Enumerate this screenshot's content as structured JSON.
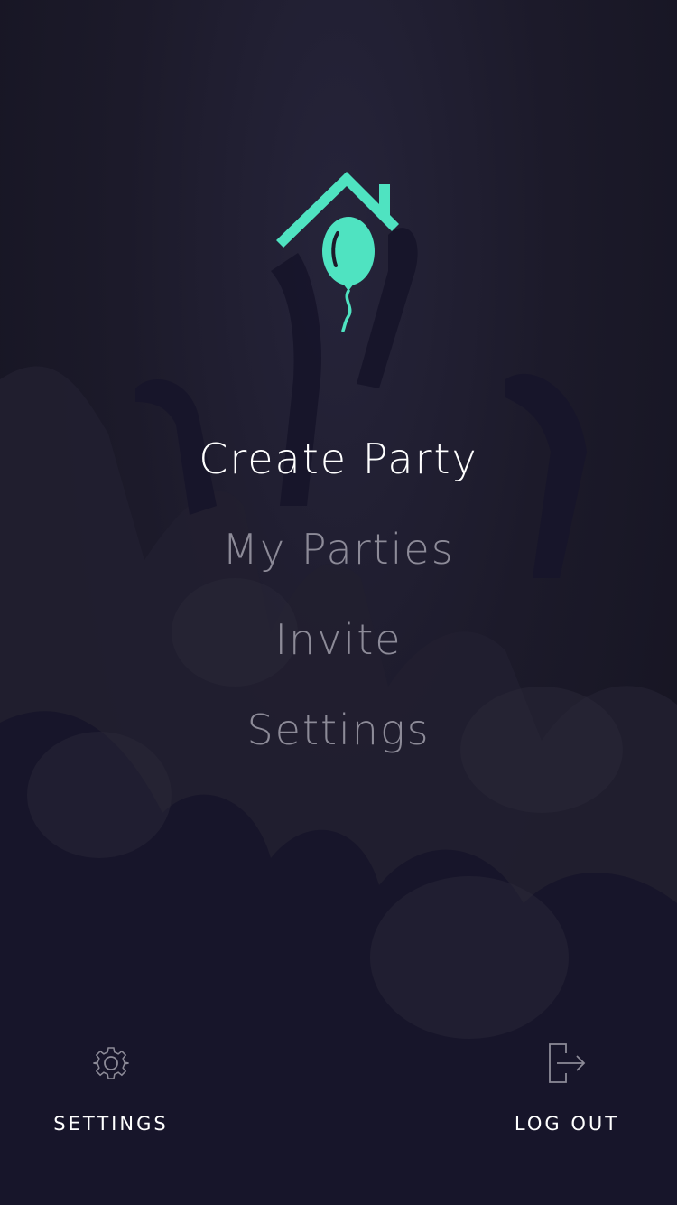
{
  "theme": {
    "accent": "#4fe3c1",
    "background": "#1a1826",
    "menu_active": "#ffffff",
    "menu_inactive": "#8d8b98"
  },
  "logo": {
    "icon": "house-balloon-logo"
  },
  "menu": {
    "items": [
      {
        "label": "Create Party",
        "active": true
      },
      {
        "label": "My Parties",
        "active": false
      },
      {
        "label": "Invite",
        "active": false
      },
      {
        "label": "Settings",
        "active": false
      }
    ]
  },
  "bottom_bar": {
    "settings": {
      "label": "SETTINGS",
      "icon": "gear-icon"
    },
    "logout": {
      "label": "LOG OUT",
      "icon": "logout-icon"
    }
  }
}
